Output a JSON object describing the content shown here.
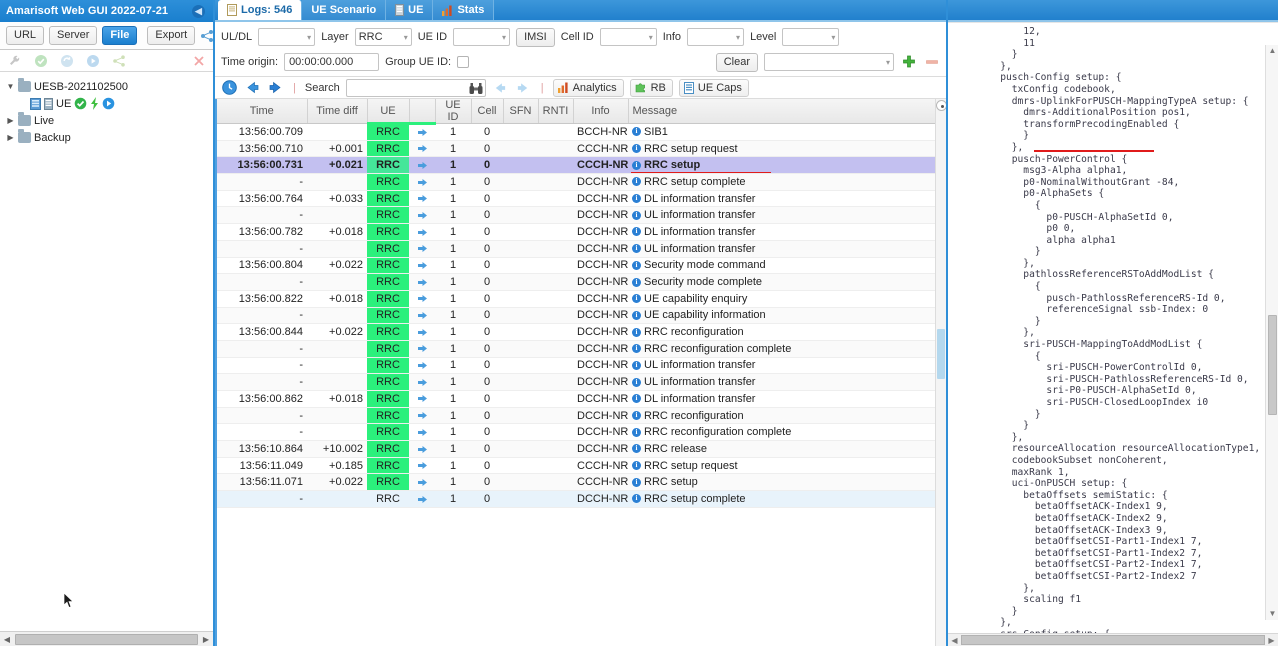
{
  "left_panel": {
    "title": "Amarisoft Web GUI 2022-07-21",
    "collapse_icon": "chevron-left-icon",
    "toolbar": {
      "url_label": "URL",
      "server_label": "Server",
      "file_label": "File",
      "export_label": "Export",
      "share_icon": "share-nodes-icon"
    },
    "toolbar2": {
      "icons": [
        "wrench-icon",
        "check-circle-icon",
        "refresh-icon",
        "play-circle-icon",
        "share-nodes-icon",
        "close-x-icon"
      ]
    },
    "tree": [
      {
        "label": "UESB-2021102500",
        "expanded": true,
        "indent": 0,
        "triangle": "▼",
        "icon": "folder-icon"
      },
      {
        "label": "UE",
        "expanded": false,
        "indent": 1,
        "triangle": "",
        "icon": "ue-device-icon",
        "badges": [
          "check-green-icon",
          "lightning-icon",
          "play-blue-icon"
        ]
      },
      {
        "label": "Live",
        "expanded": false,
        "indent": 0,
        "triangle": "▶",
        "icon": "folder-icon"
      },
      {
        "label": "Backup",
        "expanded": false,
        "indent": 0,
        "triangle": "▶",
        "icon": "folder-icon"
      }
    ]
  },
  "center_panel": {
    "tabs": [
      {
        "label": "Logs: 546",
        "icon": "document-icon",
        "active": true
      },
      {
        "label": "UE Scenario",
        "icon": "",
        "active": false
      },
      {
        "label": "UE",
        "icon": "server-icon",
        "active": false
      },
      {
        "label": "Stats",
        "icon": "bar-chart-icon",
        "active": false
      }
    ],
    "filters": {
      "uldl_label": "UL/DL",
      "uldl_value": "",
      "layer_label": "Layer",
      "layer_value": "RRC",
      "ueid_label": "UE ID",
      "ueid_value": "",
      "imsi_label": "IMSI",
      "cellid_label": "Cell ID",
      "cellid_value": "",
      "info_label": "Info",
      "info_value": "",
      "level_label": "Level",
      "level_value": "",
      "time_origin_label": "Time origin:",
      "time_origin_value": "00:00:00.000",
      "group_ueid_label": "Group UE ID:",
      "group_ueid_checked": false,
      "clear_label": "Clear",
      "preset_value": "",
      "add_icon": "plus-green-icon",
      "remove_icon": "minus-red-icon"
    },
    "toolbar": {
      "clock_icon": "clock-icon",
      "prev_icon": "arrow-left-blue-icon",
      "next_icon": "arrow-right-blue-icon",
      "search_label": "Search",
      "search_value": "",
      "search_placeholder": "",
      "binoculars_icon": "binoculars-icon",
      "search_prev_icon": "arrow-left-pale-icon",
      "search_next_icon": "arrow-right-pale-icon",
      "analytics_label": "Analytics",
      "analytics_icon": "bar-chart-icon",
      "rb_label": "RB",
      "rb_icon": "puzzle-green-icon",
      "uecaps_label": "UE Caps",
      "uecaps_icon": "document-blue-icon"
    },
    "table": {
      "columns": [
        "Time",
        "Time diff",
        "UE",
        "",
        "UE ID",
        "Cell",
        "SFN",
        "RNTI",
        "Info",
        "Message"
      ],
      "rows": [
        {
          "time": "13:56:00.709",
          "diff": "",
          "ue": "RRC",
          "ueid": "1",
          "cell": "0",
          "sfn": "",
          "rnti": "",
          "info": "BCCH-NR",
          "message": "SIB1"
        },
        {
          "time": "13:56:00.710",
          "diff": "+0.001",
          "ue": "RRC",
          "ueid": "1",
          "cell": "0",
          "sfn": "",
          "rnti": "",
          "info": "CCCH-NR",
          "message": "RRC setup request"
        },
        {
          "time": "13:56:00.731",
          "diff": "+0.021",
          "ue": "RRC",
          "ueid": "1",
          "cell": "0",
          "sfn": "",
          "rnti": "",
          "info": "CCCH-NR",
          "message": "RRC setup",
          "selected": true
        },
        {
          "time": "-",
          "diff": "",
          "ue": "RRC",
          "ueid": "1",
          "cell": "0",
          "sfn": "",
          "rnti": "",
          "info": "DCCH-NR",
          "message": "RRC setup complete"
        },
        {
          "time": "13:56:00.764",
          "diff": "+0.033",
          "ue": "RRC",
          "ueid": "1",
          "cell": "0",
          "sfn": "",
          "rnti": "",
          "info": "DCCH-NR",
          "message": "DL information transfer"
        },
        {
          "time": "-",
          "diff": "",
          "ue": "RRC",
          "ueid": "1",
          "cell": "0",
          "sfn": "",
          "rnti": "",
          "info": "DCCH-NR",
          "message": "UL information transfer"
        },
        {
          "time": "13:56:00.782",
          "diff": "+0.018",
          "ue": "RRC",
          "ueid": "1",
          "cell": "0",
          "sfn": "",
          "rnti": "",
          "info": "DCCH-NR",
          "message": "DL information transfer"
        },
        {
          "time": "-",
          "diff": "",
          "ue": "RRC",
          "ueid": "1",
          "cell": "0",
          "sfn": "",
          "rnti": "",
          "info": "DCCH-NR",
          "message": "UL information transfer"
        },
        {
          "time": "13:56:00.804",
          "diff": "+0.022",
          "ue": "RRC",
          "ueid": "1",
          "cell": "0",
          "sfn": "",
          "rnti": "",
          "info": "DCCH-NR",
          "message": "Security mode command"
        },
        {
          "time": "-",
          "diff": "",
          "ue": "RRC",
          "ueid": "1",
          "cell": "0",
          "sfn": "",
          "rnti": "",
          "info": "DCCH-NR",
          "message": "Security mode complete"
        },
        {
          "time": "13:56:00.822",
          "diff": "+0.018",
          "ue": "RRC",
          "ueid": "1",
          "cell": "0",
          "sfn": "",
          "rnti": "",
          "info": "DCCH-NR",
          "message": "UE capability enquiry"
        },
        {
          "time": "-",
          "diff": "",
          "ue": "RRC",
          "ueid": "1",
          "cell": "0",
          "sfn": "",
          "rnti": "",
          "info": "DCCH-NR",
          "message": "UE capability information"
        },
        {
          "time": "13:56:00.844",
          "diff": "+0.022",
          "ue": "RRC",
          "ueid": "1",
          "cell": "0",
          "sfn": "",
          "rnti": "",
          "info": "DCCH-NR",
          "message": "RRC reconfiguration"
        },
        {
          "time": "-",
          "diff": "",
          "ue": "RRC",
          "ueid": "1",
          "cell": "0",
          "sfn": "",
          "rnti": "",
          "info": "DCCH-NR",
          "message": "RRC reconfiguration complete"
        },
        {
          "time": "-",
          "diff": "",
          "ue": "RRC",
          "ueid": "1",
          "cell": "0",
          "sfn": "",
          "rnti": "",
          "info": "DCCH-NR",
          "message": "UL information transfer"
        },
        {
          "time": "-",
          "diff": "",
          "ue": "RRC",
          "ueid": "1",
          "cell": "0",
          "sfn": "",
          "rnti": "",
          "info": "DCCH-NR",
          "message": "UL information transfer"
        },
        {
          "time": "13:56:00.862",
          "diff": "+0.018",
          "ue": "RRC",
          "ueid": "1",
          "cell": "0",
          "sfn": "",
          "rnti": "",
          "info": "DCCH-NR",
          "message": "DL information transfer"
        },
        {
          "time": "-",
          "diff": "",
          "ue": "RRC",
          "ueid": "1",
          "cell": "0",
          "sfn": "",
          "rnti": "",
          "info": "DCCH-NR",
          "message": "RRC reconfiguration"
        },
        {
          "time": "-",
          "diff": "",
          "ue": "RRC",
          "ueid": "1",
          "cell": "0",
          "sfn": "",
          "rnti": "",
          "info": "DCCH-NR",
          "message": "RRC reconfiguration complete"
        },
        {
          "time": "13:56:10.864",
          "diff": "+10.002",
          "ue": "RRC",
          "ueid": "1",
          "cell": "0",
          "sfn": "",
          "rnti": "",
          "info": "DCCH-NR",
          "message": "RRC release"
        },
        {
          "time": "13:56:11.049",
          "diff": "+0.185",
          "ue": "RRC",
          "ueid": "1",
          "cell": "0",
          "sfn": "",
          "rnti": "",
          "info": "CCCH-NR",
          "message": "RRC setup request"
        },
        {
          "time": "13:56:11.071",
          "diff": "+0.022",
          "ue": "RRC",
          "ueid": "1",
          "cell": "0",
          "sfn": "",
          "rnti": "",
          "info": "CCCH-NR",
          "message": "RRC setup"
        },
        {
          "time": "-",
          "diff": "",
          "ue": "RRC",
          "ueid": "1",
          "cell": "0",
          "sfn": "",
          "rnti": "",
          "info": "DCCH-NR",
          "message": "RRC setup complete",
          "last": true
        }
      ]
    }
  },
  "right_panel": {
    "code": "            12,\n            11\n          }\n        },\n        pusch-Config setup: {\n          txConfig codebook,\n          dmrs-UplinkForPUSCH-MappingTypeA setup: {\n            dmrs-AdditionalPosition pos1,\n            transformPrecodingEnabled {\n            }\n          },\n          pusch-PowerControl {\n            msg3-Alpha alpha1,\n            p0-NominalWithoutGrant -84,\n            p0-AlphaSets {\n              {\n                p0-PUSCH-AlphaSetId 0,\n                p0 0,\n                alpha alpha1\n              }\n            },\n            pathlossReferenceRSToAddModList {\n              {\n                pusch-PathlossReferenceRS-Id 0,\n                referenceSignal ssb-Index: 0\n              }\n            },\n            sri-PUSCH-MappingToAddModList {\n              {\n                sri-PUSCH-PowerControlId 0,\n                sri-PUSCH-PathlossReferenceRS-Id 0,\n                sri-P0-PUSCH-AlphaSetId 0,\n                sri-PUSCH-ClosedLoopIndex i0\n              }\n            }\n          },\n          resourceAllocation resourceAllocationType1,\n          codebookSubset nonCoherent,\n          maxRank 1,\n          uci-OnPUSCH setup: {\n            betaOffsets semiStatic: {\n              betaOffsetACK-Index1 9,\n              betaOffsetACK-Index2 9,\n              betaOffsetACK-Index3 9,\n              betaOffsetCSI-Part1-Index1 7,\n              betaOffsetCSI-Part1-Index2 7,\n              betaOffsetCSI-Part2-Index1 7,\n              betaOffsetCSI-Part2-Index2 7\n            },\n            scaling f1\n          }\n        },\n        srs-Config setup: {\n          srs-ResourceSetToAddModList {"
  },
  "colors": {
    "accent_blue": "#2180cd",
    "ue_green": "#2bf07c",
    "selected_row": "#c3c0f0",
    "highlight_red": "#e01b1b",
    "last_row": "#e8f3fb"
  }
}
